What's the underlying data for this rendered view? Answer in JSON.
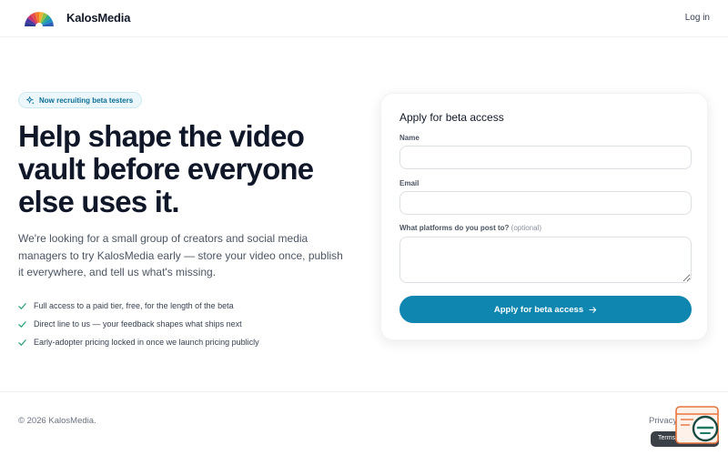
{
  "header": {
    "brand": "KalosMedia",
    "login_label": "Log in"
  },
  "hero": {
    "badge": "Now recruiting beta testers",
    "title": "Help shape the video vault before everyone else uses it.",
    "lede": "We're looking for a small group of creators and social media managers to try KalosMedia early — store your video once, publish it everywhere, and tell us what's missing.",
    "features": [
      "Full access to a paid tier, free, for the length of the beta",
      "Direct line to us — your feedback shapes what ships next",
      "Early-adopter pricing locked in once we launch pricing publicly"
    ]
  },
  "form": {
    "title": "Apply for beta access",
    "name_label": "Name",
    "name_value": "",
    "email_label": "Email",
    "email_value": "",
    "platforms_label": "What platforms do you post to?",
    "platforms_optional": "(optional)",
    "platforms_value": "",
    "submit_label": "Apply for beta access"
  },
  "footer": {
    "copyright": "© 2026 KalosMedia.",
    "privacy_label": "Privacy",
    "terms_label": "Terms"
  },
  "icons": {
    "logo": "sunburst-logo",
    "badge": "sparkles-icon",
    "feature": "check-icon",
    "submit": "arrow-right-icon",
    "widget": "help-widget-icon"
  },
  "colors": {
    "accent": "#0e86af",
    "badge_text": "#0b6f94",
    "check": "#1f9d6b",
    "widget": "#e8743b"
  }
}
